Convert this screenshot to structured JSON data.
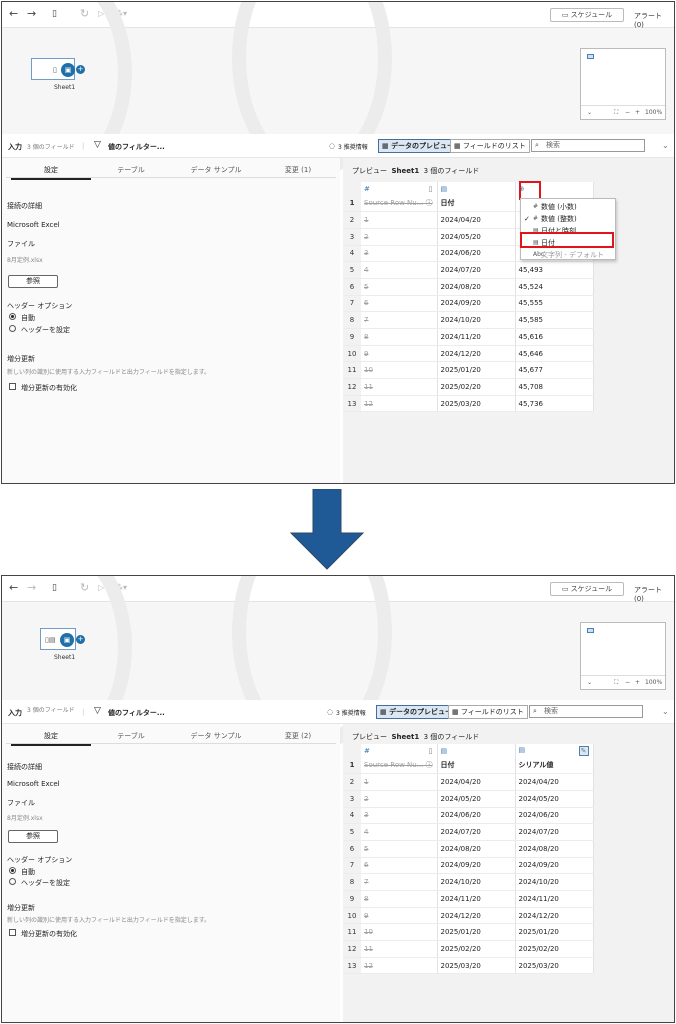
{
  "toolbar": {
    "schedule_label": "スケジュール",
    "alert_label": "アラート (0)"
  },
  "canvas": {
    "node_label": "Sheet1",
    "zoom": "100%",
    "zoom_minus": "−",
    "zoom_plus": "+"
  },
  "subbar": {
    "input_label": "入力",
    "field_count": "3 個のフィールド",
    "filter_label": "値のフィルター...",
    "recommend_label": "3 推奨情報",
    "data_preview_label": "データのプレビュー",
    "field_list_label": "フィールドのリスト",
    "search_placeholder": "検索"
  },
  "left": {
    "tabs": [
      "設定",
      "テーブル",
      "データ サンプル"
    ],
    "changes_top": "変更 (1)",
    "changes_bottom": "変更 (2)",
    "connection_details": "接続の詳細",
    "connection_type": "Microsoft Excel",
    "file_label": "ファイル",
    "file_name": "8月定例.xlsx",
    "browse_label": "参照",
    "header_options": "ヘッダー オプション",
    "auto_label": "自動",
    "set_header_label": "ヘッダーを設定",
    "incremental_title": "増分更新",
    "incremental_desc": "新しい列の識別に使用する入力フィールドと出力フィールドを指定します。",
    "incremental_enable": "増分更新の有効化"
  },
  "preview": {
    "title": "プレビュー",
    "sheet": "Sheet1",
    "count": "3 個のフィールド",
    "col1_header": "Source Row Nu...",
    "col2_header": "日付",
    "col3_header_bottom": "シリアル値",
    "row_numbers": [
      "1",
      "2",
      "3",
      "4",
      "5",
      "6",
      "7",
      "8",
      "9",
      "10",
      "11",
      "12",
      "13"
    ],
    "source_rows": [
      "1",
      "2",
      "3",
      "4",
      "5",
      "6",
      "7",
      "8",
      "9",
      "10",
      "11",
      "12"
    ],
    "dates": [
      "2024/04/20",
      "2024/05/20",
      "2024/06/20",
      "2024/07/20",
      "2024/08/20",
      "2024/09/20",
      "2024/10/20",
      "2024/11/20",
      "2024/12/20",
      "2025/01/20",
      "2025/02/20",
      "2025/03/20"
    ],
    "serials_top": [
      "",
      "",
      "",
      "45,493",
      "45,524",
      "45,555",
      "45,585",
      "45,616",
      "45,646",
      "45,677",
      "45,708",
      "45,736"
    ]
  },
  "dropdown": {
    "items": [
      "数値 (小数)",
      "数値 (整数)",
      "日付と時刻",
      "日付",
      "文字列 - デフォルト"
    ]
  },
  "colors": {
    "accent": "#1f6fa8",
    "highlight": "#e0151c",
    "arrow": "#1f5a96"
  }
}
